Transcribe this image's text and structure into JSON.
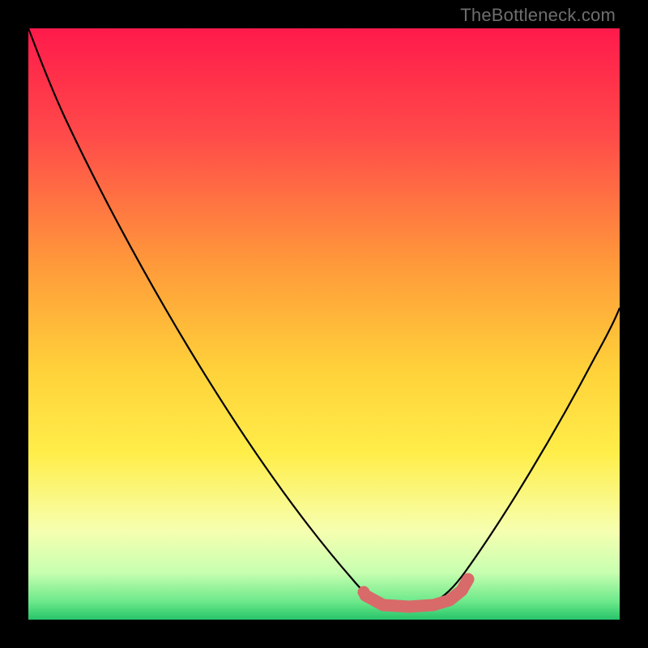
{
  "watermark": "TheBottleneck.com",
  "chart_data": {
    "type": "line",
    "title": "",
    "xlabel": "",
    "ylabel": "",
    "xlim": [
      0,
      100
    ],
    "ylim": [
      0,
      100
    ],
    "grid": false,
    "legend": false,
    "gradient_stops": [
      {
        "pct": 0,
        "color": "#ff1a4b"
      },
      {
        "pct": 18,
        "color": "#ff4a4a"
      },
      {
        "pct": 40,
        "color": "#ff9a3a"
      },
      {
        "pct": 58,
        "color": "#ffd23a"
      },
      {
        "pct": 72,
        "color": "#ffee4a"
      },
      {
        "pct": 85,
        "color": "#f6ffb0"
      },
      {
        "pct": 92,
        "color": "#c8ffb0"
      },
      {
        "pct": 97,
        "color": "#6be88a"
      },
      {
        "pct": 100,
        "color": "#27c46a"
      }
    ],
    "series": [
      {
        "name": "bottleneck-curve",
        "color": "#000000",
        "stroke_width": 2,
        "x": [
          0,
          3,
          8,
          15,
          25,
          35,
          45,
          53,
          58,
          62,
          66,
          70,
          73,
          77,
          81,
          86,
          92,
          97,
          100
        ],
        "y": [
          100,
          95,
          86,
          75,
          58,
          42,
          26,
          14,
          8,
          4,
          2,
          2,
          4,
          9,
          17,
          27,
          40,
          51,
          58
        ]
      },
      {
        "name": "optimal-marker",
        "type": "marker",
        "color": "#d86a6a",
        "x": [
          57,
          60,
          63,
          66,
          69,
          71,
          72.5,
          74
        ],
        "y": [
          3.5,
          2.5,
          2.2,
          2.2,
          2.5,
          3.2,
          4.2,
          6.0
        ],
        "stroke_width": 14,
        "linecap": "round"
      }
    ],
    "optimal_range_x": [
      58,
      74
    ]
  }
}
